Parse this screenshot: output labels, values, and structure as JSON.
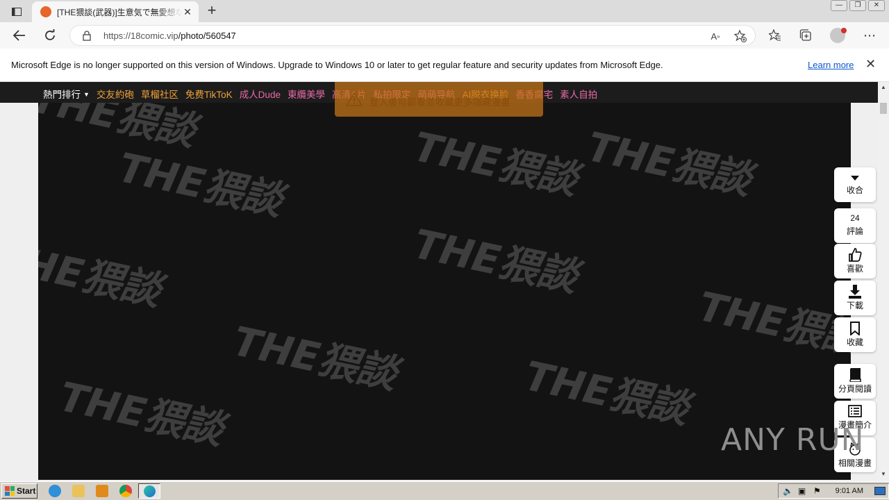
{
  "browser": {
    "tab_title": "[THE猥談(武器)]生意気で無愛想な",
    "url_host": "https://18comic.vip",
    "url_path": "/photo/560547",
    "close_tab_glyph": "✕",
    "new_tab_glyph": "+"
  },
  "infobar": {
    "message": "Microsoft Edge is no longer supported on this version of Windows. Upgrade to Windows 10 or later to get regular feature and security updates from Microsoft Edge.",
    "link": "Learn more"
  },
  "site_nav": {
    "hot": "熱門排行",
    "items": [
      {
        "label": "交友約砲",
        "color": "#f0a23a"
      },
      {
        "label": "草榴社区",
        "color": "#f0a23a"
      },
      {
        "label": "免费TikToK",
        "color": "#f0a23a"
      },
      {
        "label": "成人Dude",
        "color": "#e86aa8"
      },
      {
        "label": "東纜美學",
        "color": "#e86aa8"
      },
      {
        "label": "高清A片",
        "color": "#e86aa8"
      },
      {
        "label": "私拍限定",
        "color": "#e86aa8"
      },
      {
        "label": "萌萌导航",
        "color": "#e86aa8"
      },
      {
        "label": "AI脱衣换脸",
        "color": "#f0a23a"
      },
      {
        "label": "香香腐宅",
        "color": "#e86aa8"
      },
      {
        "label": "素人自拍",
        "color": "#e86aa8"
      }
    ]
  },
  "toast": {
    "text": "登入後可觀看並收藏更多隱藏漫畫"
  },
  "watermark": {
    "text": "THE猥談"
  },
  "side_toolbar": {
    "collapse": "收合",
    "comments_count": "24",
    "comments": "評論",
    "like": "喜歡",
    "download": "下載",
    "favorite": "收藏",
    "page_read": "分頁閱讀",
    "intro": "漫畫簡介",
    "related": "相關漫畫"
  },
  "anyrun": "ANY RUN",
  "taskbar": {
    "start": "Start",
    "clock": "9:01 AM"
  }
}
